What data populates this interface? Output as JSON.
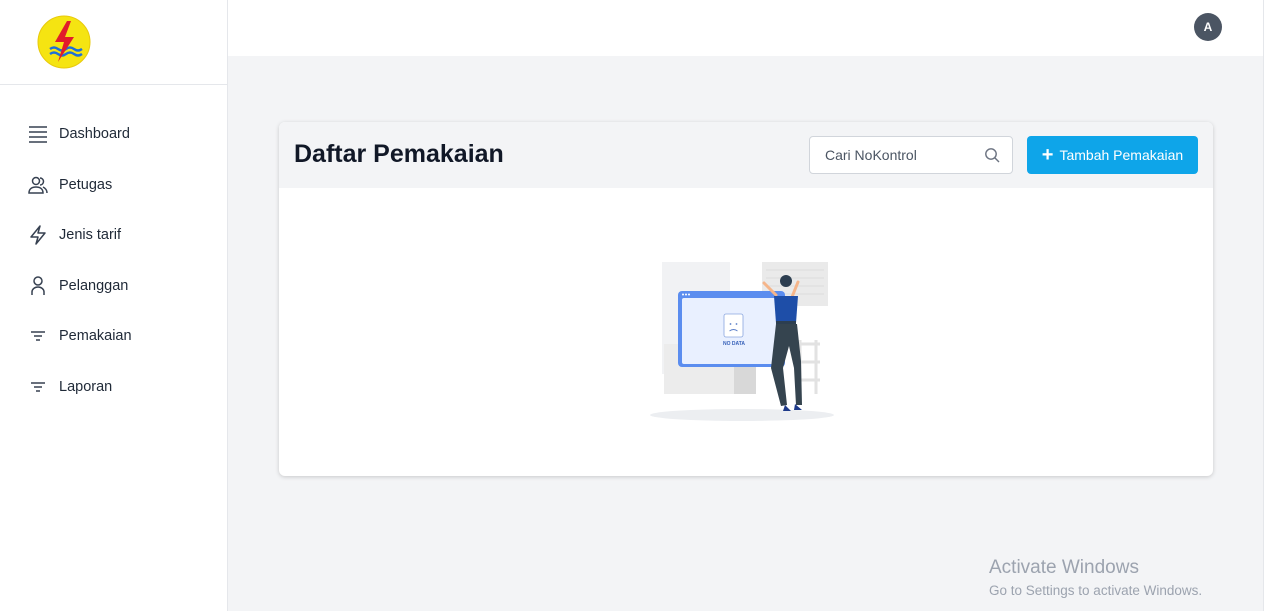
{
  "brand": {
    "logo_colors": {
      "circle": "#f5e412",
      "bolt": "#e11d2a",
      "waves": "#1e6fd9"
    }
  },
  "sidebar": {
    "items": [
      {
        "label": "Dashboard",
        "icon": "menu-lines-icon"
      },
      {
        "label": "Petugas",
        "icon": "users-icon"
      },
      {
        "label": "Jenis tarif",
        "icon": "lightning-icon"
      },
      {
        "label": "Pelanggan",
        "icon": "user-icon"
      },
      {
        "label": "Pemakaian",
        "icon": "filter-icon"
      },
      {
        "label": "Laporan",
        "icon": "filter-icon"
      }
    ]
  },
  "header": {
    "avatar_initial": "A"
  },
  "main": {
    "title": "Daftar Pemakaian",
    "search": {
      "placeholder": "Cari NoKontrol",
      "value": ""
    },
    "add_button": {
      "label": "Tambah Pemakaian",
      "icon": "plus-icon"
    },
    "empty_state": {
      "illustration_text": "NO DATA"
    }
  },
  "watermark": {
    "title": "Activate Windows",
    "subtitle": "Go to Settings to activate Windows."
  },
  "colors": {
    "accent": "#0ea5e9",
    "avatar_bg": "#4b5563",
    "page_bg": "#f3f4f6"
  }
}
